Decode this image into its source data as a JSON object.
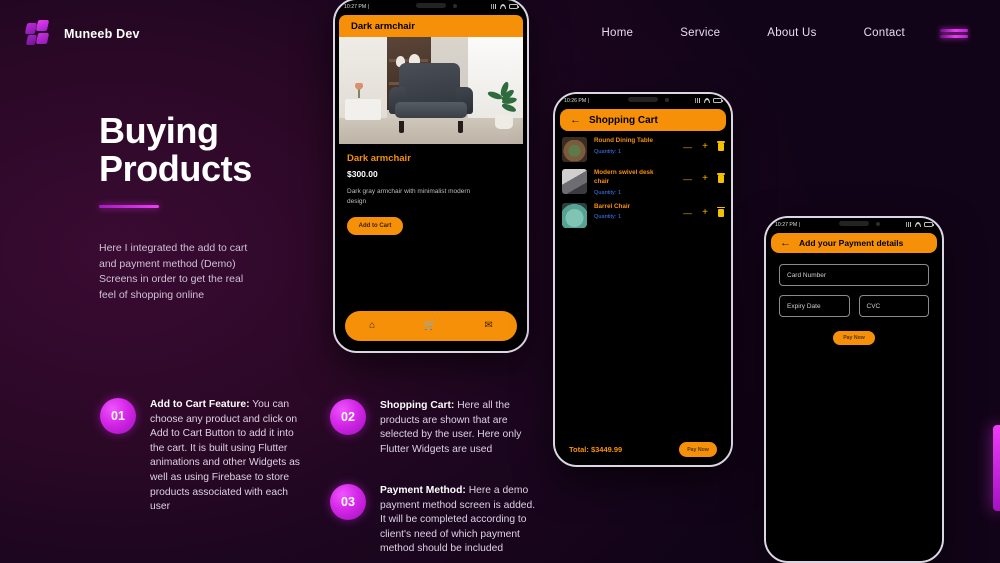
{
  "header": {
    "brand": "Muneeb Dev",
    "logo_icon": "logo-diamond-icon",
    "nav": [
      {
        "label": "Home"
      },
      {
        "label": "Service"
      },
      {
        "label": "About Us"
      },
      {
        "label": "Contact"
      }
    ],
    "menu_icon": "hamburger-menu-icon"
  },
  "hero": {
    "title_line1": "Buying",
    "title_line2": "Products",
    "description": "Here I integrated the add to cart and payment method (Demo) Screens in order to get the real feel of shopping online"
  },
  "features": [
    {
      "number": "01",
      "title": "Add to Cart Feature:",
      "body": " You can choose any product and click on Add to Cart Button to add it into the cart. It is built using Flutter animations and other Widgets as well as using Firebase to store products associated with each user"
    },
    {
      "number": "02",
      "title": "Shopping Cart:",
      "body": " Here all the products are shown that are selected by the user. Here only Flutter Widgets are used"
    },
    {
      "number": "03",
      "title": "Payment Method:",
      "body": " Here a demo payment method screen is added. It will be completed according to client's need of which payment method should be included"
    }
  ],
  "phone_product": {
    "status_time": "10:27 PM |",
    "appbar_title": "Dark armchair",
    "product_name": "Dark armchair",
    "product_price": "$300.00",
    "product_desc": "Dark gray armchair with minimalist modern design",
    "cta_label": "Add to Cart",
    "nav_icons": {
      "home": "⌂",
      "cart": "🛒",
      "mail": "✉"
    }
  },
  "phone_cart": {
    "status_time": "10:26 PM |",
    "back_icon": "←",
    "appbar_title": "Shopping Cart",
    "items": [
      {
        "name": "Round Dining Table",
        "quantity": "Quantity: 1"
      },
      {
        "name": "Modern swivel desk chair",
        "quantity": "Quantity: 1"
      },
      {
        "name": "Barrel Chair",
        "quantity": "Quantity: 1"
      }
    ],
    "total_label": "Total: $3449.99",
    "pay_label": "Pay Now"
  },
  "phone_payment": {
    "status_time": "10:27 PM |",
    "back_icon": "←",
    "appbar_title": "Add your Payment details",
    "card_number_placeholder": "Card Number",
    "expiry_placeholder": "Expiry Date",
    "cvc_placeholder": "CVC",
    "pay_label": "Pay Now"
  },
  "colors": {
    "accent_orange": "#f79009",
    "accent_magenta": "#e83df2",
    "quantity_blue": "#3d7df7",
    "background_purple": "#2b0826"
  }
}
